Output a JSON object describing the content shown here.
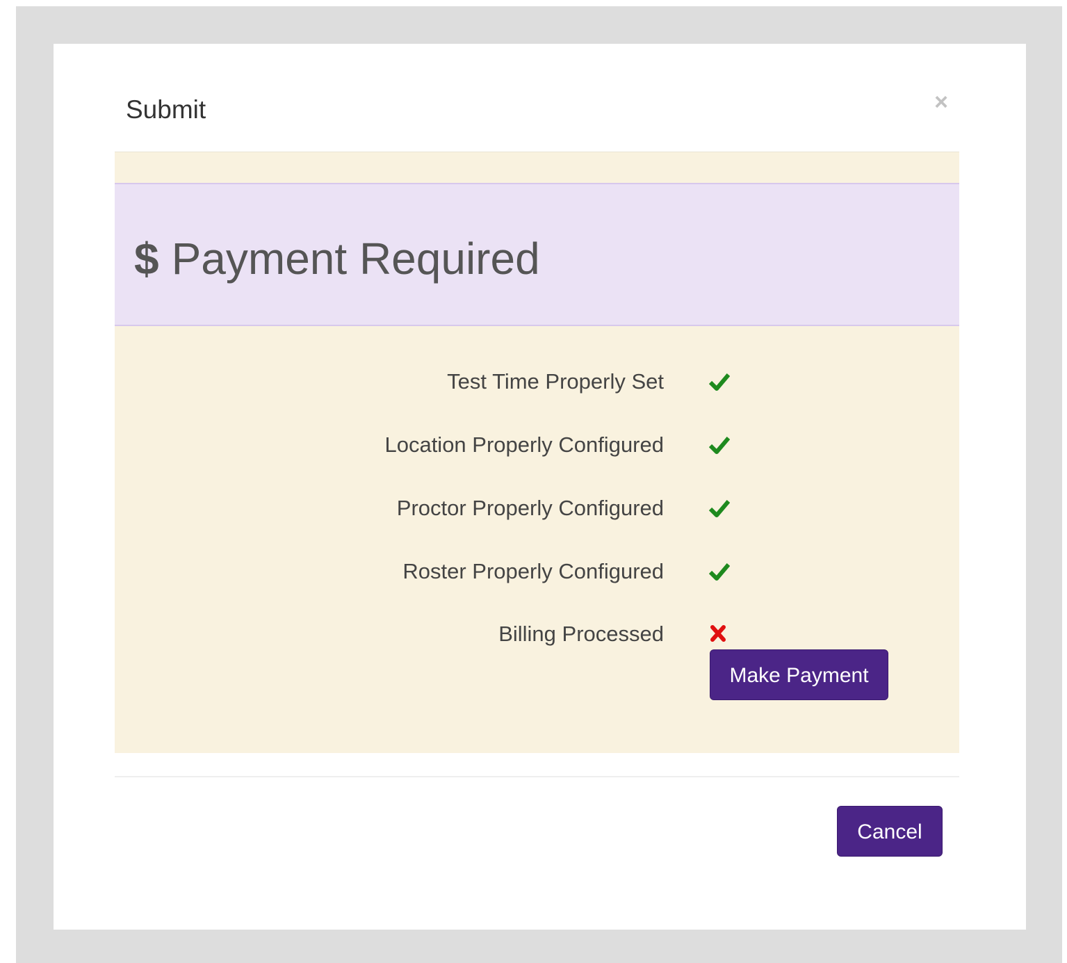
{
  "dialog": {
    "title": "Submit",
    "close_symbol": "×"
  },
  "banner": {
    "icon": "$",
    "title": "Payment Required",
    "background_color": "#ebe2f5"
  },
  "checklist": [
    {
      "label": "Test Time Properly Set",
      "status": "ok",
      "icon": "checkmark-icon"
    },
    {
      "label": "Location Properly Configured",
      "status": "ok",
      "icon": "checkmark-icon"
    },
    {
      "label": "Proctor Properly Configured",
      "status": "ok",
      "icon": "checkmark-icon"
    },
    {
      "label": "Roster Properly Configured",
      "status": "ok",
      "icon": "checkmark-icon"
    },
    {
      "label": "Billing Processed",
      "status": "failed",
      "icon": "cross-icon"
    }
  ],
  "buttons": {
    "make_payment": "Make Payment",
    "cancel": "Cancel"
  },
  "colors": {
    "primary_button": "#4b2587",
    "panel_background": "#f9f2df",
    "ok": "#1e8a1e",
    "failed": "#e01010"
  }
}
